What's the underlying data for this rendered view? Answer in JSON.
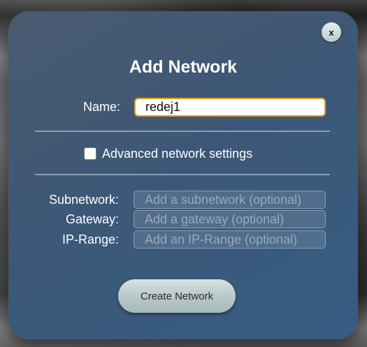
{
  "dialog": {
    "title": "Add Network",
    "close_label": "x",
    "name": {
      "label": "Name:",
      "value": "redej1"
    },
    "advanced": {
      "label": "Advanced network settings",
      "checked": false
    },
    "subnetwork": {
      "label": "Subnetwork:",
      "placeholder": "Add a subnetwork (optional)"
    },
    "gateway": {
      "label": "Gateway:",
      "placeholder": "Add a gateway (optional)"
    },
    "ip_range": {
      "label": "IP-Range:",
      "placeholder": "Add an IP-Range (optional)"
    },
    "create_label": "Create Network"
  },
  "colors": {
    "accent_focus": "#e4a21a",
    "dialog_bg": "#3d5877",
    "text": "#ffffff"
  },
  "icons": {
    "close": "close-icon",
    "checkbox": "checkbox-unchecked"
  }
}
